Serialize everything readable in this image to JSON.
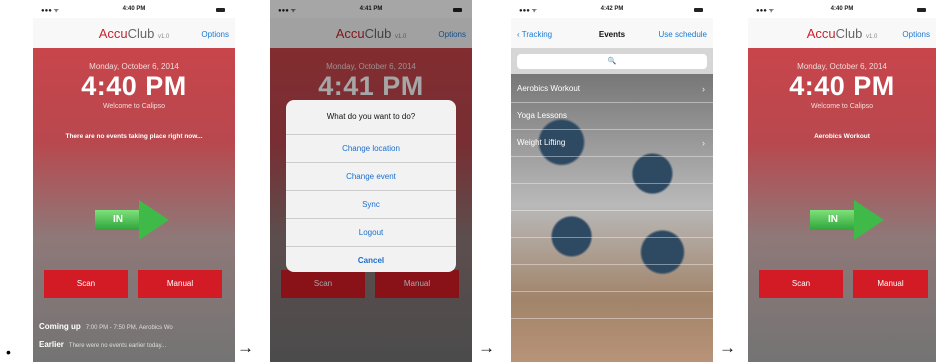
{
  "flow": {
    "bullet": "•",
    "arrow": "→"
  },
  "status": {
    "signal": "●●● ᯤ",
    "times": [
      "4:40 PM",
      "4:41 PM",
      "4:42 PM",
      "4:40 PM"
    ]
  },
  "app": {
    "logo_accu": "Accu",
    "logo_club": "Club",
    "version": "v1.0",
    "options": "Options"
  },
  "screen1": {
    "date": "Monday, October 6, 2014",
    "time": "4:40 PM",
    "welcome": "Welcome to Calipso",
    "message": "There are no events taking place right now...",
    "in_label": "IN",
    "scan": "Scan",
    "manual": "Manual",
    "coming_up_label": "Coming up",
    "coming_up_text": "7:00 PM - 7:50 PM, Aerobics Wo",
    "earlier_label": "Earlier",
    "earlier_text": "There were no events earlier today..."
  },
  "screen2": {
    "date": "Monday, October 6, 2014",
    "time": "4:41 PM",
    "dialog_title": "What do you want to do?",
    "options": [
      "Change location",
      "Change event",
      "Sync",
      "Logout",
      "Cancel"
    ],
    "scan": "Scan",
    "manual": "Manual"
  },
  "screen3": {
    "back": "Tracking",
    "title": "Events",
    "right": "Use schedule",
    "search_icon": "🔍",
    "events": [
      "Aerobics Workout",
      "Yoga Lessons",
      "Weight Lifting"
    ],
    "chevron": "›"
  },
  "screen4": {
    "date": "Monday, October 6, 2014",
    "time": "4:40 PM",
    "welcome": "Welcome to Calipso",
    "message": "Aerobics Workout",
    "in_label": "IN",
    "scan": "Scan",
    "manual": "Manual"
  },
  "colors": {
    "brand_red": "#d31b26",
    "ios_blue": "#1a7ad6",
    "in_green": "#3fb947"
  }
}
